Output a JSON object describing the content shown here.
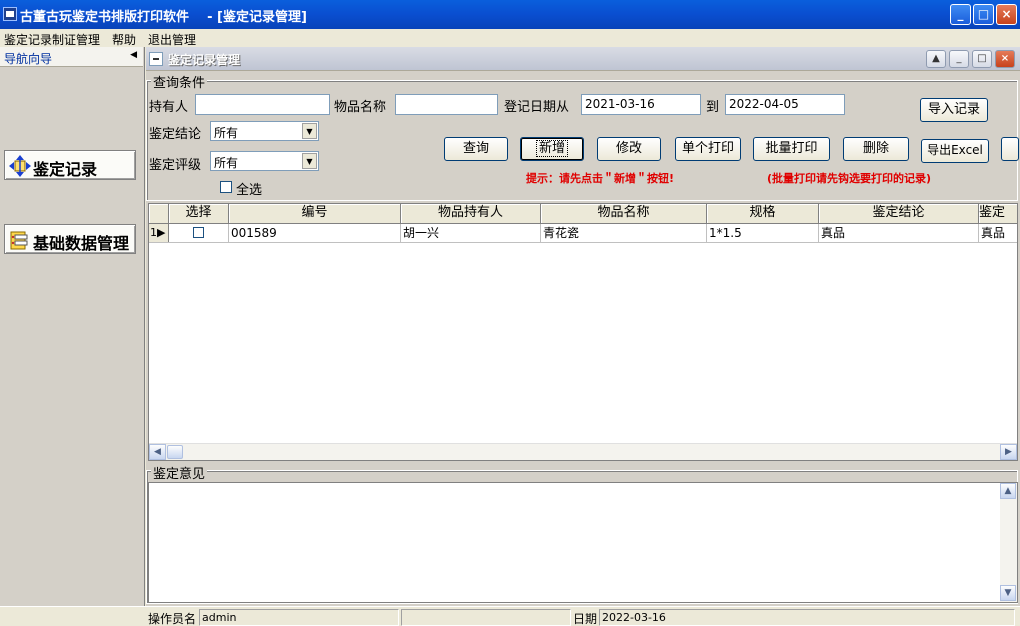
{
  "window": {
    "title": "古董古玩鉴定书排版打印软件    - [鉴定记录管理]",
    "controls": {
      "minimize": "_",
      "maximize": "□",
      "close": "×"
    }
  },
  "menu": [
    "鉴定记录制证管理",
    "帮助",
    "退出管理"
  ],
  "nav": {
    "header": "导航向导",
    "collapse_arrow": "◀",
    "items": [
      {
        "label": "鉴定记录",
        "icon": "record-arrows-icon"
      },
      {
        "label": "基础数据管理",
        "icon": "folder-data-icon"
      }
    ]
  },
  "child": {
    "title": "鉴定记录管理",
    "controls": {
      "restore": "▲",
      "minimize": "_",
      "maximize": "□",
      "close": "×"
    }
  },
  "query": {
    "legend": "查询条件",
    "holder_label": "持有人",
    "holder_value": "",
    "item_label": "物品名称",
    "item_value": "",
    "date_from_label": "登记日期从",
    "date_from": "2021-03-16",
    "date_to_label": "到",
    "date_to": "2022-04-05",
    "conclusion_label": "鉴定结论",
    "conclusion_value": "所有",
    "grade_label": "鉴定评级",
    "grade_value": "所有",
    "select_all_label": "全选"
  },
  "buttons": {
    "import": "导入记录",
    "search": "查询",
    "add": "新增",
    "edit": "修改",
    "print_single": "单个打印",
    "print_batch": "批量打印",
    "delete": "删除",
    "export": "导出Excel"
  },
  "hints": {
    "add": "提示：请先点击＂新增＂按钮!",
    "batch": "(批量打印请先钩选要打印的记录)"
  },
  "grid": {
    "columns": [
      "选择",
      "编号",
      "物品持有人",
      "物品名称",
      "规格",
      "鉴定结论",
      "鉴定"
    ],
    "rows": [
      {
        "index": "1",
        "code": "001589",
        "holder": "胡一兴",
        "item": "青花瓷",
        "spec": "1*1.5",
        "conclusion": "真品",
        "extra": "真品"
      }
    ]
  },
  "opinion": {
    "legend": "鉴定意见",
    "value": ""
  },
  "status": {
    "operator_label": "操作员名",
    "operator": "admin",
    "date_label": "日期",
    "date": "2022-03-16"
  }
}
